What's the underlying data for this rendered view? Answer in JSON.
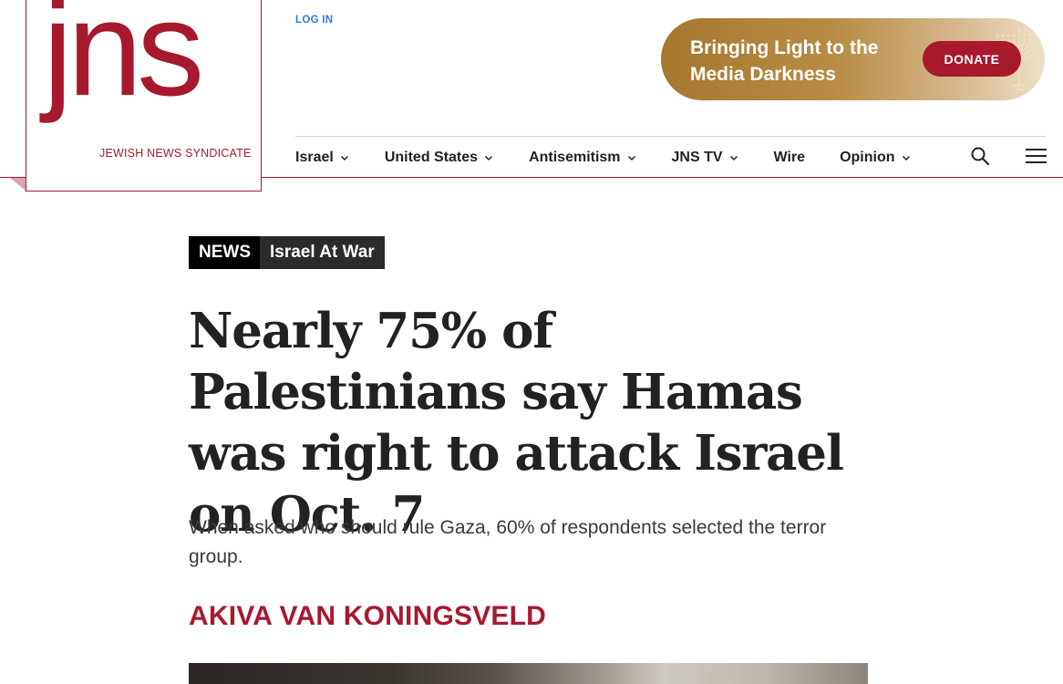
{
  "header": {
    "logo_word": "jns",
    "logo_tagline": "JEWISH NEWS SYNDICATE",
    "login_label": "LOG IN",
    "donate_banner_text": "Bringing Light to the Media Darkness",
    "donate_button_label": "DONATE"
  },
  "nav": {
    "items": [
      {
        "label": "Israel",
        "has_dropdown": true
      },
      {
        "label": "United States",
        "has_dropdown": true
      },
      {
        "label": "Antisemitism",
        "has_dropdown": true
      },
      {
        "label": "JNS TV",
        "has_dropdown": true
      },
      {
        "label": "Wire",
        "has_dropdown": false
      },
      {
        "label": "Opinion",
        "has_dropdown": true
      }
    ],
    "icons": [
      "search-icon",
      "hamburger-menu-icon"
    ]
  },
  "article": {
    "category": "NEWS",
    "subcategory": "Israel At War",
    "headline": "Nearly 75% of Palestinians say Hamas was right to attack Israel on Oct. 7",
    "subheadline": "When asked who should rule Gaza, 60% of respondents selected the terror group.",
    "author": "AKIVA VAN KONINGSVELD"
  },
  "colors": {
    "brand": "#a8192e",
    "link": "#2e7bd1",
    "text": "#222222"
  }
}
